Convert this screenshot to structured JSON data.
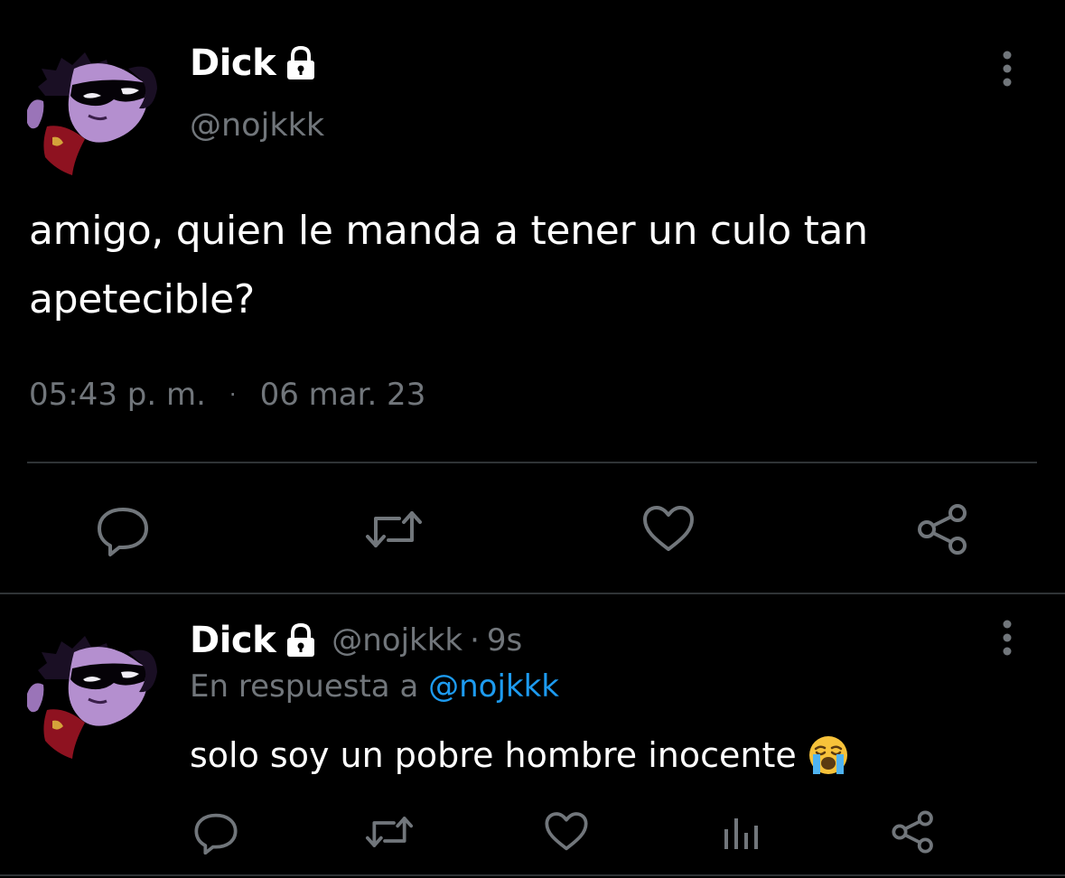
{
  "tweet": {
    "author": {
      "display_name": "Dick",
      "handle": "@nojkkk",
      "avatar_icon": "avatar-robin-icon",
      "protected_icon": "lock-icon"
    },
    "text": "amigo, quien le manda a tener un culo tan apetecible?",
    "time": "05:43 p. m.",
    "separator": "·",
    "date": "06 mar. 23",
    "actions": [
      "reply-icon",
      "retweet-icon",
      "like-icon",
      "share-icon"
    ]
  },
  "reply": {
    "author": {
      "display_name": "Dick",
      "handle": "@nojkkk",
      "avatar_icon": "avatar-robin-icon",
      "protected_icon": "lock-icon"
    },
    "separator": "·",
    "age": "9s",
    "in_reply_to_label": "En respuesta a",
    "in_reply_to_handle": "@nojkkk",
    "text": "solo soy un pobre hombre inocente",
    "emoji": "loudly-crying-face-icon",
    "actions": [
      "reply-icon",
      "retweet-icon",
      "like-icon",
      "views-icon",
      "share-icon"
    ]
  },
  "colors": {
    "background": "#000000",
    "text_primary": "#ffffff",
    "text_secondary": "#71767b",
    "link": "#1d9bf0",
    "divider": "#2f3336"
  }
}
